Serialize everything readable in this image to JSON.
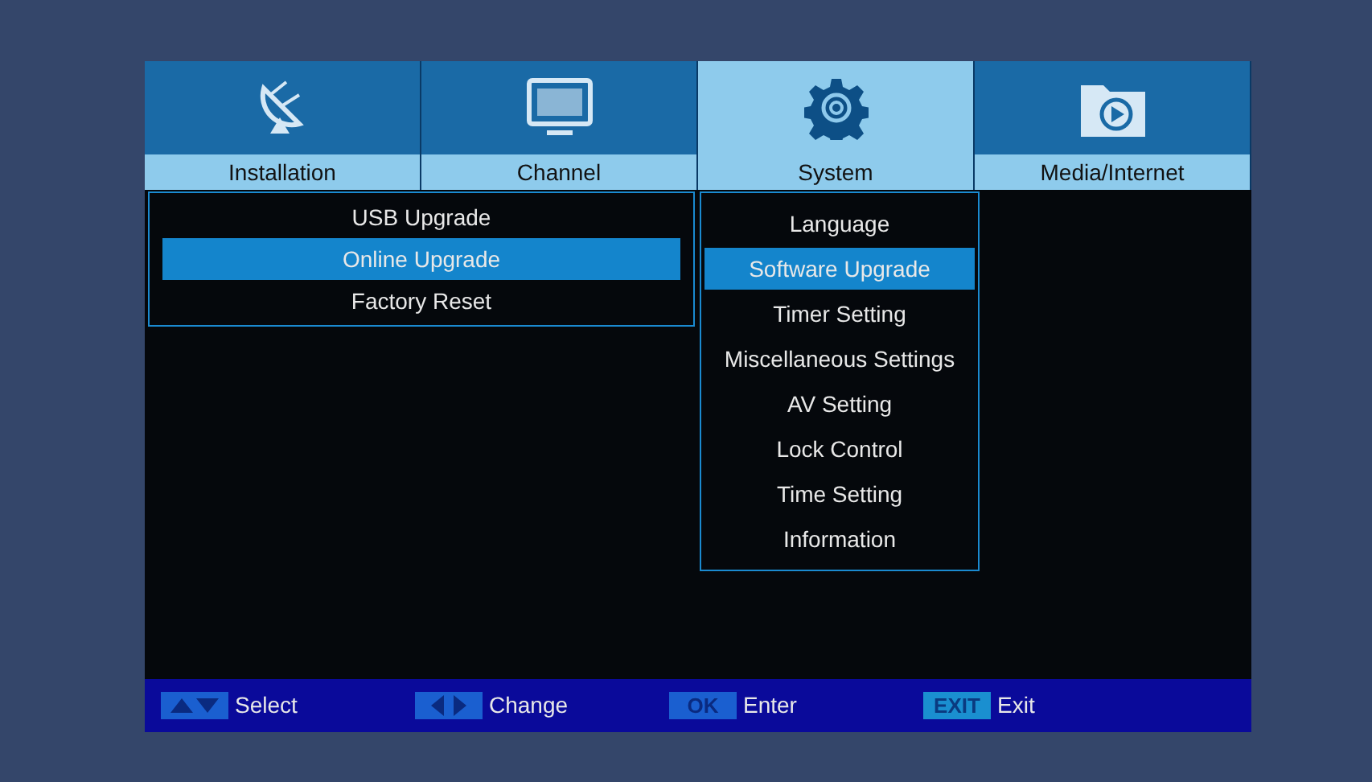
{
  "tabs": [
    {
      "label": "Installation",
      "kind": "dish",
      "selected": false
    },
    {
      "label": "Channel",
      "kind": "tv",
      "selected": false
    },
    {
      "label": "System",
      "kind": "gear",
      "selected": true
    },
    {
      "label": "Media/Internet",
      "kind": "folder",
      "selected": false
    }
  ],
  "submenu": [
    {
      "label": "USB Upgrade",
      "selected": false
    },
    {
      "label": "Online Upgrade",
      "selected": true
    },
    {
      "label": "Factory Reset",
      "selected": false
    }
  ],
  "system_menu": [
    {
      "label": "Language",
      "selected": false
    },
    {
      "label": "Software Upgrade",
      "selected": true
    },
    {
      "label": "Timer Setting",
      "selected": false
    },
    {
      "label": "Miscellaneous Settings",
      "selected": false
    },
    {
      "label": "AV Setting",
      "selected": false
    },
    {
      "label": "Lock Control",
      "selected": false
    },
    {
      "label": "Time Setting",
      "selected": false
    },
    {
      "label": "Information",
      "selected": false
    }
  ],
  "hints": [
    {
      "kind": "updown",
      "label": "Select"
    },
    {
      "kind": "leftright",
      "label": "Change"
    },
    {
      "kind": "text",
      "key": "OK",
      "label": "Enter"
    },
    {
      "kind": "exit",
      "key": "EXIT",
      "label": "Exit"
    }
  ]
}
